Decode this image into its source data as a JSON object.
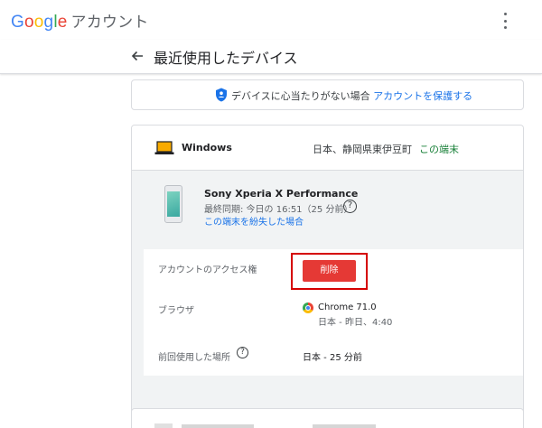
{
  "header": {
    "logo_letters": [
      "G",
      "o",
      "o",
      "g",
      "l",
      "e"
    ],
    "product": "アカウント",
    "more_icon": "more-vert-icon"
  },
  "titlebar": {
    "back_icon": "arrow-back-icon",
    "title": "最近使用したデバイス"
  },
  "notice": {
    "icon": "shield-person-icon",
    "text": "デバイスに心当たりがない場合",
    "link": "アカウントを保護する"
  },
  "device_group": {
    "icon": "laptop-icon",
    "title": "Windows",
    "location": "日本、静岡県東伊豆町",
    "this_device": "この端末"
  },
  "device": {
    "icon": "phone-icon",
    "name": "Sony Xperia X Performance",
    "sync": "最終同期: 今日の 16:51（25 分前）",
    "lost_link": "この端末を紛失した場合"
  },
  "details": {
    "access_label": "アカウントのアクセス権",
    "remove_button": "削除",
    "browser_label": "ブラウザ",
    "browser_name": "Chrome 71.0",
    "browser_time": "日本 - 昨日、4:40",
    "last_location_label": "前回使用した場所",
    "last_location": "日本 - 25 分前"
  },
  "colors": {
    "accent": "#1a73e8",
    "remove_button": "#e53935",
    "highlight_border": "#d50000",
    "this_device": "#188038"
  }
}
